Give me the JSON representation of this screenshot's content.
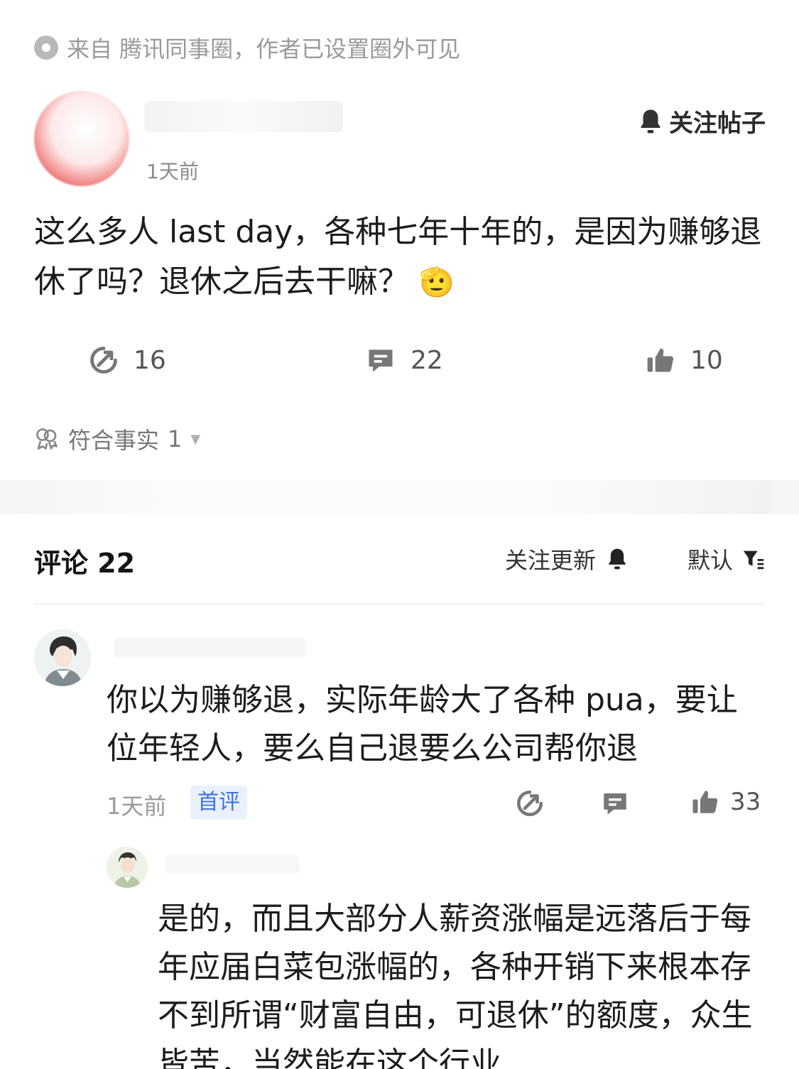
{
  "source": {
    "text": "来自 腾讯同事圈，作者已设置圈外可见"
  },
  "post": {
    "time": "1天前",
    "follow_label": "关注帖子",
    "content": "这么多人 last day，各种七年十年的，是因为赚够退休了吗？退休之后去干嘛？",
    "emoji": "🫡",
    "share_count": "16",
    "comment_count": "22",
    "like_count": "10",
    "fact_label": "符合事实",
    "fact_count": "1"
  },
  "comments_header": {
    "title": "评论 22",
    "follow_updates": "关注更新",
    "sort_label": "默认"
  },
  "comments": [
    {
      "text": "你以为赚够退，实际年龄大了各种 pua，要让位年轻人，要么自己退要么公司帮你退",
      "time": "1天前",
      "badge": "首评",
      "like_count": "33"
    }
  ],
  "replies": [
    {
      "text": "是的，而且大部分人薪资涨幅是远落后于每年应届白菜包涨幅的，各种开销下来根本存不到所谓“财富自由，可退休”的额度，众生皆苦，当然能在这个行业"
    }
  ],
  "colors": {
    "accent_blue": "#3d73dd",
    "badge_bg": "#eaf1fd",
    "muted_text": "#9a9a9a",
    "divider_band": "#f4f5f7"
  }
}
